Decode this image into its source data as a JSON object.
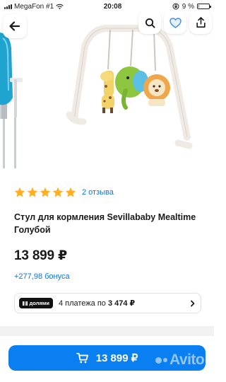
{
  "status_bar": {
    "carrier": "MegaFon #1",
    "time": "20:08",
    "battery_text": "9 %",
    "battery_level": 0.09,
    "battery_color": "#e03a2f"
  },
  "header": {
    "back_icon": "arrow-left-icon",
    "search_icon": "search-icon",
    "favorite_icon": "heart-icon",
    "share_icon": "share-icon"
  },
  "product": {
    "rating_stars": 5,
    "star_color": "#ffb021",
    "reviews_label": "2 отзыва",
    "title": "Стул для кормления Sevillababy Mealtime Голубой",
    "price": "13 899 ₽",
    "bonus": "+277,98 бонуса"
  },
  "installments": {
    "badge_label": "долями",
    "text_prefix": "4 платежа по ",
    "amount": "3 474 ₽"
  },
  "buy_button": {
    "price_label": "13 899 ₽",
    "icon": "cart-icon",
    "color": "#0a7ff2"
  },
  "watermark": {
    "text": "Avito"
  },
  "colors": {
    "accent": "#0a75e3",
    "chair_blue": "#1fa3cf"
  }
}
